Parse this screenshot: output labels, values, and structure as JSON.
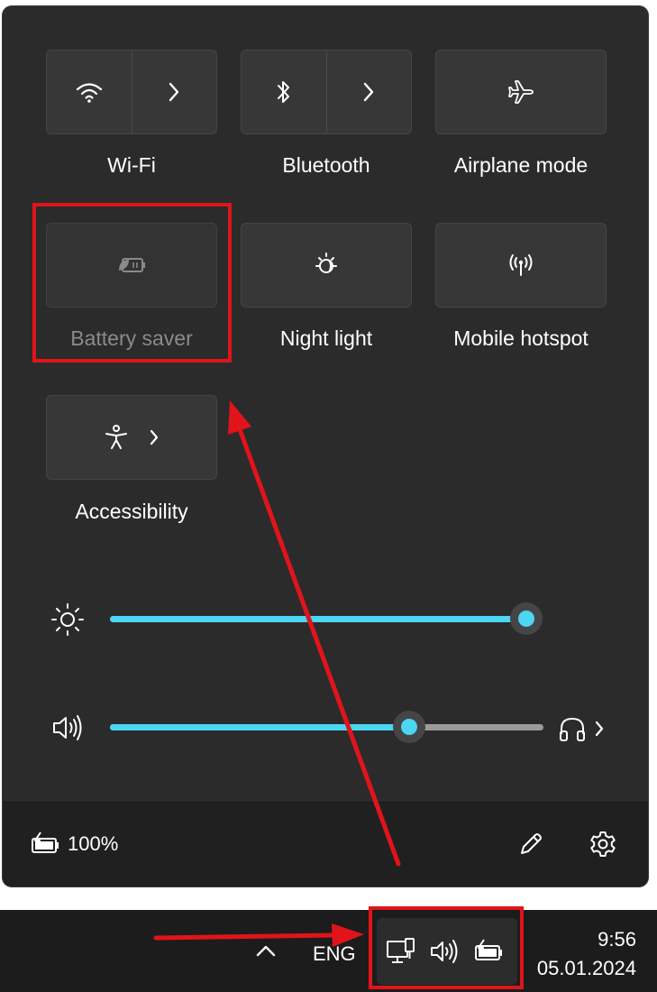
{
  "tiles": {
    "wifi": {
      "label": "Wi-Fi",
      "icon": "wifi-icon"
    },
    "bluetooth": {
      "label": "Bluetooth",
      "icon": "bluetooth-icon"
    },
    "airplane": {
      "label": "Airplane mode",
      "icon": "airplane-icon"
    },
    "battery_saver": {
      "label": "Battery saver",
      "icon": "battery-saver-icon",
      "state": "disabled"
    },
    "night_light": {
      "label": "Night light",
      "icon": "night-light-icon"
    },
    "mobile_hotspot": {
      "label": "Mobile hotspot",
      "icon": "hotspot-icon"
    },
    "accessibility": {
      "label": "Accessibility",
      "icon": "accessibility-icon"
    }
  },
  "sliders": {
    "brightness": {
      "value_percent": 100,
      "icon": "sun-icon"
    },
    "volume": {
      "value_percent": 69,
      "icon": "speaker-icon",
      "output_icon": "headphones-icon"
    }
  },
  "footer": {
    "battery_text": "100%",
    "edit_icon": "pencil-icon",
    "settings_icon": "gear-icon"
  },
  "taskbar": {
    "language": "ENG",
    "time": "9:56",
    "date": "05.01.2024",
    "tray_icons": [
      "network-icon",
      "speaker-icon",
      "battery-charging-icon"
    ]
  },
  "colors": {
    "accent": "#4cd6f2",
    "panel_bg": "#2b2b2b",
    "annotation_red": "#e0141a"
  }
}
